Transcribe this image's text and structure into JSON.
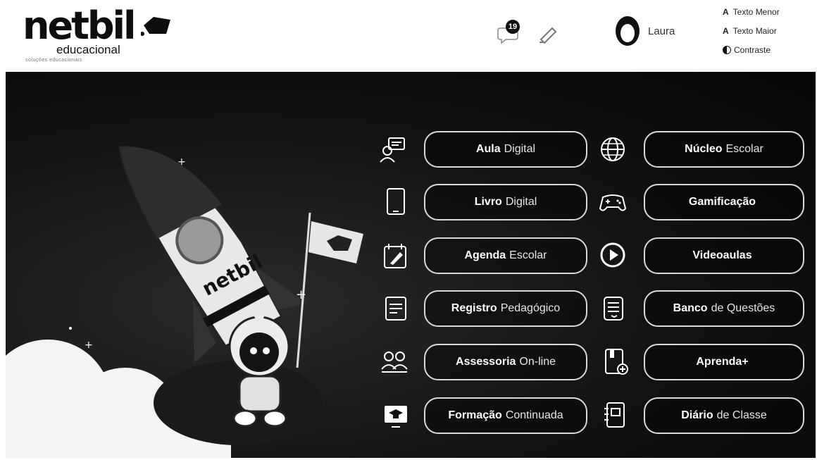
{
  "header": {
    "logo": {
      "word": "netbil",
      "sub": "educacional",
      "tagline": "soluções educacionais"
    },
    "notifications": {
      "count": "19"
    },
    "user": {
      "name": "Laura"
    },
    "accessibility": {
      "smaller_label": "Texto Menor",
      "larger_label": "Texto Maior",
      "contrast_label": "Contraste",
      "a_glyph": "A"
    }
  },
  "menu": {
    "left": [
      {
        "bold": "Aula",
        "light": "Digital",
        "icon": "chat-monitor-icon"
      },
      {
        "bold": "Livro",
        "light": "Digital",
        "icon": "tablet-icon"
      },
      {
        "bold": "Agenda",
        "light": "Escolar",
        "icon": "calendar-pencil-icon"
      },
      {
        "bold": "Registro",
        "light": "Pedagógico",
        "icon": "document-icon"
      },
      {
        "bold": "Assessoria",
        "light": "On-line",
        "icon": "people-icon"
      },
      {
        "bold": "Formação",
        "light": "Continuada",
        "icon": "graduation-screen-icon"
      }
    ],
    "right": [
      {
        "bold": "Núcleo",
        "light": "Escolar",
        "icon": "globe-icon"
      },
      {
        "bold": "Gamificação",
        "light": "",
        "icon": "gamepad-icon"
      },
      {
        "bold": "Videoaulas",
        "light": "",
        "icon": "play-icon"
      },
      {
        "bold": "Banco",
        "light": "de Questões",
        "icon": "question-list-icon"
      },
      {
        "bold": "Aprenda+",
        "light": "",
        "icon": "book-plus-icon"
      },
      {
        "bold": "Diário",
        "light": "de Classe",
        "icon": "notebook-icon"
      }
    ]
  },
  "illustration": {
    "rocket_text": "netbil"
  },
  "colors": {
    "hero_bg": "#111111",
    "button_border": "#d9d9d9",
    "text_on_dark": "#ffffff"
  }
}
